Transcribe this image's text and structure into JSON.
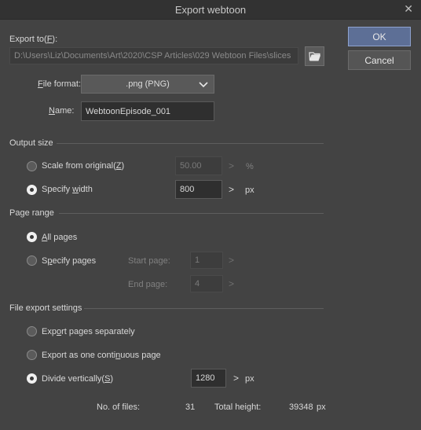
{
  "window": {
    "title": "Export webtoon",
    "close_glyph": "✕"
  },
  "buttons": {
    "ok": "OK",
    "cancel": "Cancel"
  },
  "export_to": {
    "label_pre": "Export to(",
    "label_key": "F",
    "label_post": "):",
    "path": "D:\\Users\\Liz\\Documents\\Art\\2020\\CSP Articles\\029 Webtoon Files\\slices",
    "browse_icon": "folder-open-icon"
  },
  "file_format": {
    "label_key": "F",
    "label_rest": "ile format:",
    "value": ".png (PNG)"
  },
  "name": {
    "label_key": "N",
    "label_rest": "ame:",
    "value": "WebtoonEpisode_001"
  },
  "output_size": {
    "heading": "Output size",
    "scale_pre": "Scale from original(",
    "scale_key": "Z",
    "scale_post": ")",
    "scale_value": "50.00",
    "scale_unit": "%",
    "width_pre": "Specify ",
    "width_key": "w",
    "width_post": "idth",
    "width_value": "800",
    "width_unit": "px",
    "selected": "specify_width"
  },
  "page_range": {
    "heading": "Page range",
    "all_key": "A",
    "all_rest": "ll pages",
    "specify_pre": "S",
    "specify_key": "p",
    "specify_post": "ecify pages",
    "start_label": "Start page:",
    "start_value": "1",
    "end_label": "End page:",
    "end_value": "4",
    "selected": "all"
  },
  "file_export": {
    "heading": "File export settings",
    "separate_pre": "Exp",
    "separate_key": "o",
    "separate_post": "rt pages separately",
    "continuous_pre": "Export as one conti",
    "continuous_key": "n",
    "continuous_post": "uous page",
    "divide_pre": "Divide vertically(",
    "divide_key": "S",
    "divide_post": ")",
    "divide_value": "1280",
    "divide_unit": "px",
    "selected": "divide"
  },
  "summary": {
    "files_label": "No. of files:",
    "files_value": "31",
    "height_label": "Total height:",
    "height_value": "39348",
    "height_unit": "px"
  },
  "glyphs": {
    "arrow": ">"
  }
}
